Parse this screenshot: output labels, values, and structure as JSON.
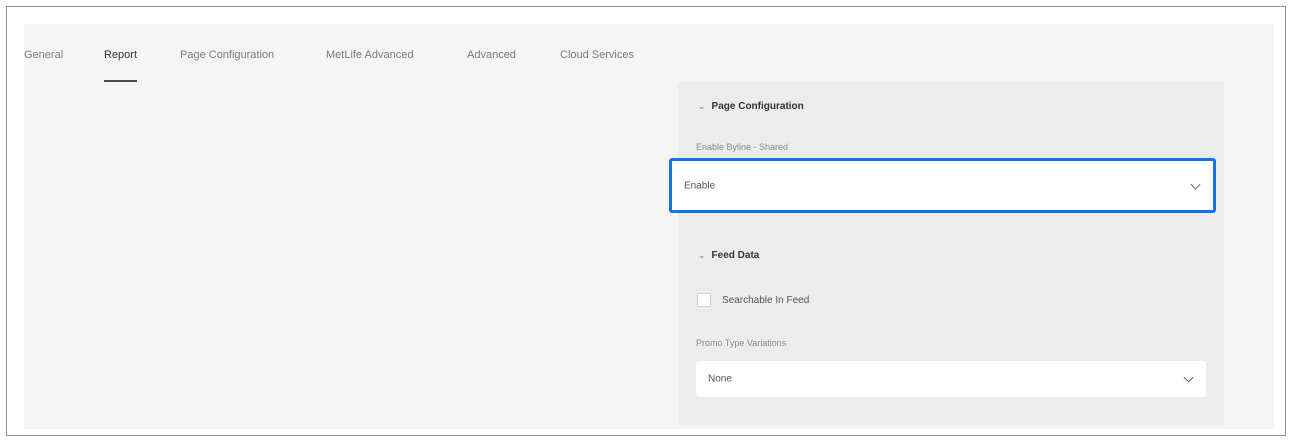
{
  "tabs": [
    {
      "label": "General",
      "active": false
    },
    {
      "label": "Report",
      "active": true
    },
    {
      "label": "Page Configuration",
      "active": false
    },
    {
      "label": "MetLife Advanced",
      "active": false
    },
    {
      "label": "Advanced",
      "active": false
    },
    {
      "label": "Cloud Services",
      "active": false
    }
  ],
  "page_config": {
    "heading": "Page Configuration",
    "byline_label": "Enable Byline - Shared",
    "byline_value": "Enable"
  },
  "feed_data": {
    "heading": "Feed Data",
    "searchable_label": "Searchable In Feed",
    "searchable_checked": false,
    "promo_label": "Promo Type Variations",
    "promo_value": "None"
  },
  "colors": {
    "focus_border": "#1473e6",
    "panel_bg": "#f5f5f5",
    "side_bg": "#ececec"
  },
  "icons": {
    "section_toggle": "chevron-down-icon",
    "select_arrow": "chevron-down-icon"
  }
}
